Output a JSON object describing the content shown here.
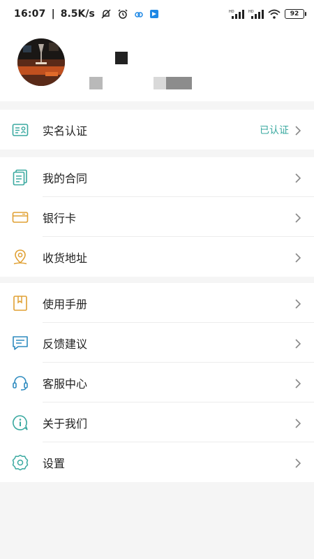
{
  "status_bar": {
    "time": "16:07",
    "network_speed": "8.5K/s",
    "battery": "92",
    "signal_badge": "HD"
  },
  "profile": {
    "avatar_icon": "user-photo"
  },
  "verification": {
    "label": "实名认证",
    "status": "已认证"
  },
  "group_account": {
    "items": [
      {
        "label": "我的合同",
        "icon": "contract-icon"
      },
      {
        "label": "银行卡",
        "icon": "bank-card-icon"
      },
      {
        "label": "收货地址",
        "icon": "location-icon"
      }
    ]
  },
  "group_support": {
    "items": [
      {
        "label": "使用手册",
        "icon": "manual-icon"
      },
      {
        "label": "反馈建议",
        "icon": "feedback-icon"
      },
      {
        "label": "客服中心",
        "icon": "headset-icon"
      },
      {
        "label": "关于我们",
        "icon": "info-icon"
      },
      {
        "label": "设置",
        "icon": "gear-icon"
      }
    ]
  },
  "colors": {
    "accent_teal": "#3aa9a0",
    "icon_orange": "#e0a033",
    "icon_blue": "#2e8bbf"
  }
}
